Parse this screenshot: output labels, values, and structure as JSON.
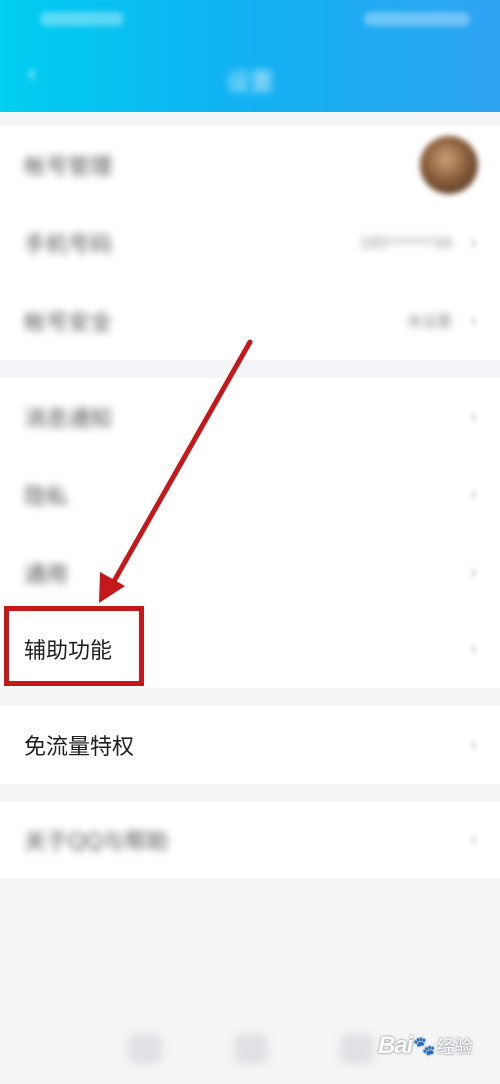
{
  "header": {
    "title": "设置",
    "back_icon": "chevron-left-icon"
  },
  "group1": [
    {
      "label": "帐号管理"
    },
    {
      "label": "手机号码",
      "value": "185******34"
    },
    {
      "label": "帐号安全",
      "value": "未设置"
    }
  ],
  "group2": [
    {
      "label": "消息通知"
    },
    {
      "label": "隐私"
    },
    {
      "label": "通用"
    },
    {
      "label": "辅助功能"
    }
  ],
  "group3": [
    {
      "label": "免流量特权"
    }
  ],
  "group4": [
    {
      "label": "关于QQ与帮助"
    }
  ],
  "chevron": "›",
  "watermark": {
    "brand": "Bai",
    "paw": "🐾",
    "sub": "经验"
  },
  "colors": {
    "header_gradient_start": "#00cff0",
    "header_gradient_end": "#2ea3f2",
    "annotation_red": "#c4181b",
    "background": "#f4f5f7"
  }
}
